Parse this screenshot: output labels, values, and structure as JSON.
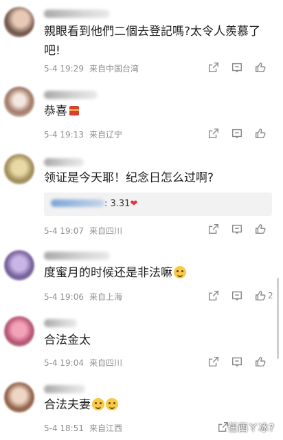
{
  "comments": [
    {
      "text": "親眼看到他們二個去登記嗎?太令人羨慕了吧!",
      "date": "5-4 19:29",
      "location": "来自中国台湾",
      "likes": ""
    },
    {
      "text": "恭喜",
      "date": "5-4 19:13",
      "location": "来自辽宁",
      "likes": ""
    },
    {
      "text": "领证是今天耶！纪念日怎么过啊?",
      "date": "5-4 19:07",
      "location": "来自四川",
      "likes": "",
      "reply_value": ": 3.31",
      "reply_heart": "❤"
    },
    {
      "text": "度蜜月的时候还是非法嘛",
      "date": "5-4 19:06",
      "location": "来自上海",
      "likes": "2"
    },
    {
      "text": "合法金太",
      "date": "5-4 19:04",
      "location": "来自四川",
      "likes": ""
    },
    {
      "text": "合法夫妻",
      "date": "5-4 18:51",
      "location": "来自江西",
      "likes": ""
    }
  ],
  "icons": {
    "share": "share-icon",
    "comment": "comment-icon",
    "like": "thumbs-up-icon"
  },
  "watermark": "任西ㄚ冰?"
}
